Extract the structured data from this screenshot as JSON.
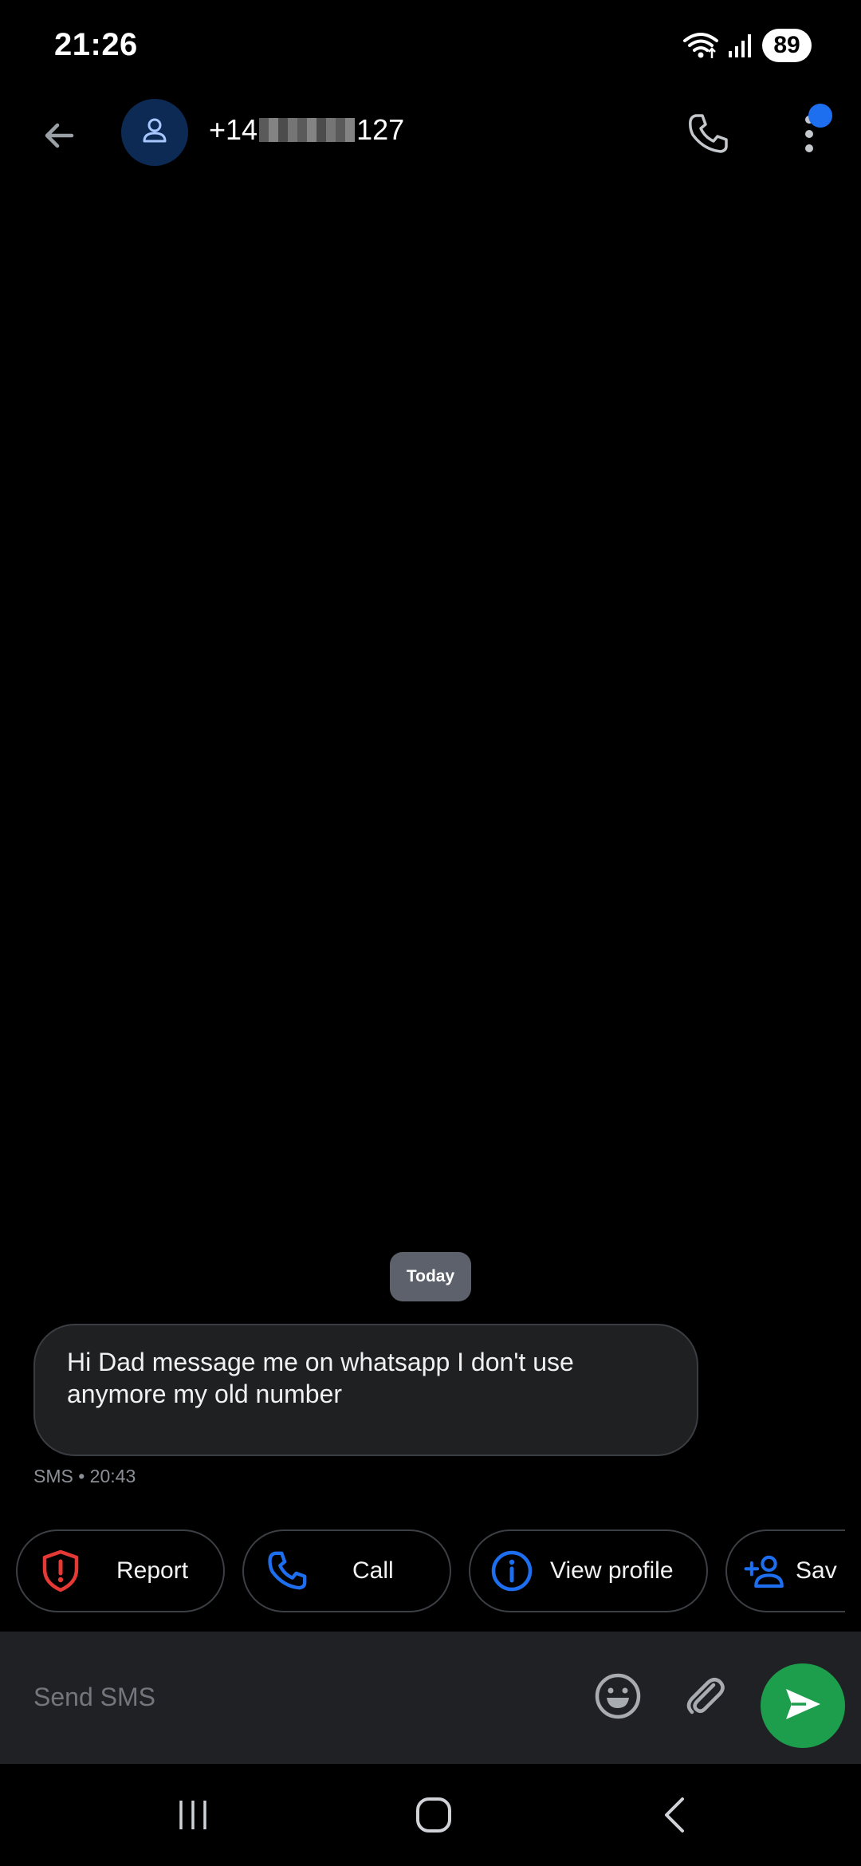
{
  "status_bar": {
    "time": "21:26",
    "battery": "89",
    "icons": [
      "wifi-icon",
      "signal-icon",
      "battery-icon"
    ]
  },
  "header": {
    "number_prefix": "+14",
    "number_suffix": "127",
    "back_icon": "arrow-left-icon",
    "call_icon": "phone-icon",
    "menu_icon": "more-vertical-icon",
    "avatar_icon": "person-icon"
  },
  "conversation": {
    "date_chip": "Today",
    "messages": [
      {
        "text": "Hi Dad message me on whatsapp I don't use anymore my old number",
        "meta": "SMS • 20:43"
      }
    ]
  },
  "suggestions": [
    {
      "label": "Report",
      "icon": "shield-alert-icon",
      "color": "#e53935"
    },
    {
      "label": "Call",
      "icon": "phone-icon",
      "color": "#1e6ff0"
    },
    {
      "label": "View profile",
      "icon": "info-icon",
      "color": "#1e6ff0"
    },
    {
      "label": "Sav",
      "icon": "add-person-icon",
      "color": "#1e6ff0"
    }
  ],
  "compose": {
    "placeholder": "Send SMS",
    "emoji_icon": "emoji-icon",
    "attach_icon": "paperclip-icon",
    "send_icon": "send-icon"
  },
  "colors": {
    "background": "#000000",
    "accent_blue": "#1e6ff0",
    "send_green": "#1c9e4d",
    "report_red": "#e53935",
    "bubble": "#1f2022",
    "compose_bg": "#202124"
  }
}
